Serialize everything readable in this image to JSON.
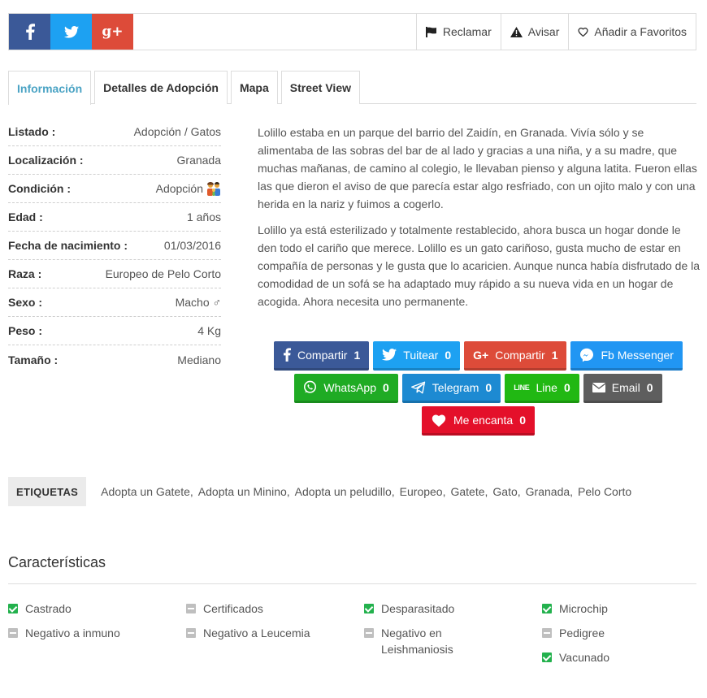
{
  "topbar": {
    "social": [
      {
        "icon": "facebook-icon",
        "glyph": "f"
      },
      {
        "icon": "twitter-icon",
        "glyph": ""
      },
      {
        "icon": "google-plus-icon",
        "glyph": "g+"
      }
    ],
    "actions": [
      {
        "icon": "flag-icon",
        "label": "Reclamar"
      },
      {
        "icon": "warning-icon",
        "label": "Avisar"
      },
      {
        "icon": "heart-outline-icon",
        "label": "Añadir a Favoritos"
      }
    ]
  },
  "tabs": [
    {
      "label": "Información",
      "active": true
    },
    {
      "label": "Detalles de Adopción",
      "active": false
    },
    {
      "label": "Mapa",
      "active": false
    },
    {
      "label": "Street View",
      "active": false
    }
  ],
  "info": [
    {
      "label": "Listado :",
      "value": "Adopción / Gatos"
    },
    {
      "label": "Localización :",
      "value": "Granada"
    },
    {
      "label": "Condición :",
      "value": "Adopción",
      "icon": "family-icon"
    },
    {
      "label": "Edad :",
      "value": "1 años"
    },
    {
      "label": "Fecha de nacimiento :",
      "value": "01/03/2016"
    },
    {
      "label": "Raza :",
      "value": "Europeo de Pelo Corto"
    },
    {
      "label": "Sexo :",
      "value": "Macho ♂"
    },
    {
      "label": "Peso :",
      "value": "4 Kg"
    },
    {
      "label": "Tamaño :",
      "value": "Mediano"
    }
  ],
  "description": [
    "Lolillo estaba en un parque del barrio del Zaidín, en Granada. Vivía sólo y se alimentaba de las sobras del bar de al lado y gracias a una niña, y a su madre, que muchas mañanas, de camino al colegio, le llevaban pienso y alguna latita. Fueron ellas las que dieron el aviso de que parecía estar algo resfriado, con un ojito malo y con una herida en la nariz y fuimos a cogerlo.",
    "Lolillo ya está esterilizado y totalmente restablecido, ahora busca un hogar donde le den todo el cariño que merece. Lolillo es un gato cariñoso, gusta mucho de estar en compañía de personas y le gusta que lo acaricien. Aunque nunca había disfrutado de la comodidad de un sofá se ha adaptado muy rápido a su nueva vida en un hogar de acogida. Ahora necesita uno permanente."
  ],
  "share": [
    {
      "key": "facebook",
      "label": "Compartir",
      "count": "1",
      "icon": "facebook-icon",
      "glyph": "f",
      "color": "#3b5998"
    },
    {
      "key": "twitter",
      "label": "Tuitear",
      "count": "0",
      "icon": "twitter-icon",
      "glyph": "",
      "color": "#1da1f2"
    },
    {
      "key": "googleplus",
      "label": "Compartir",
      "count": "1",
      "icon": "google-plus-icon",
      "glyph": "G+",
      "color": "#dd4b39"
    },
    {
      "key": "messenger",
      "label": "Fb Messenger",
      "count": "",
      "icon": "messenger-icon",
      "glyph": "",
      "color": "#2196f3"
    },
    {
      "key": "whatsapp",
      "label": "WhatsApp",
      "count": "0",
      "icon": "whatsapp-icon",
      "glyph": "",
      "color": "#1fab24"
    },
    {
      "key": "telegram",
      "label": "Telegram",
      "count": "0",
      "icon": "telegram-icon",
      "glyph": "",
      "color": "#1d8ad2"
    },
    {
      "key": "line",
      "label": "Line",
      "count": "0",
      "icon": "line-icon",
      "glyph": "LINE",
      "color": "#21b813"
    },
    {
      "key": "email",
      "label": "Email",
      "count": "0",
      "icon": "envelope-icon",
      "glyph": "",
      "color": "#5e5e5e"
    },
    {
      "key": "love",
      "label": "Me encanta",
      "count": "0",
      "icon": "heart-icon",
      "glyph": "",
      "color": "#e4102a"
    }
  ],
  "tags": {
    "label": "ETIQUETAS",
    "items": [
      "Adopta un Gatete",
      "Adopta un Minino",
      "Adopta un peludillo",
      "Europeo",
      "Gatete",
      "Gato",
      "Granada",
      "Pelo Corto"
    ]
  },
  "features": {
    "title": "Características",
    "columns": [
      [
        {
          "label": "Castrado",
          "checked": true
        },
        {
          "label": "Negativo a inmuno",
          "checked": false
        }
      ],
      [
        {
          "label": "Certificados",
          "checked": false
        },
        {
          "label": "Negativo a Leucemia",
          "checked": false
        }
      ],
      [
        {
          "label": "Desparasitado",
          "checked": true
        },
        {
          "label": "Negativo en Leishmaniosis",
          "checked": false
        }
      ],
      [
        {
          "label": "Microchip",
          "checked": true
        },
        {
          "label": "Pedigree",
          "checked": false
        },
        {
          "label": "Vacunado",
          "checked": true
        }
      ]
    ]
  }
}
